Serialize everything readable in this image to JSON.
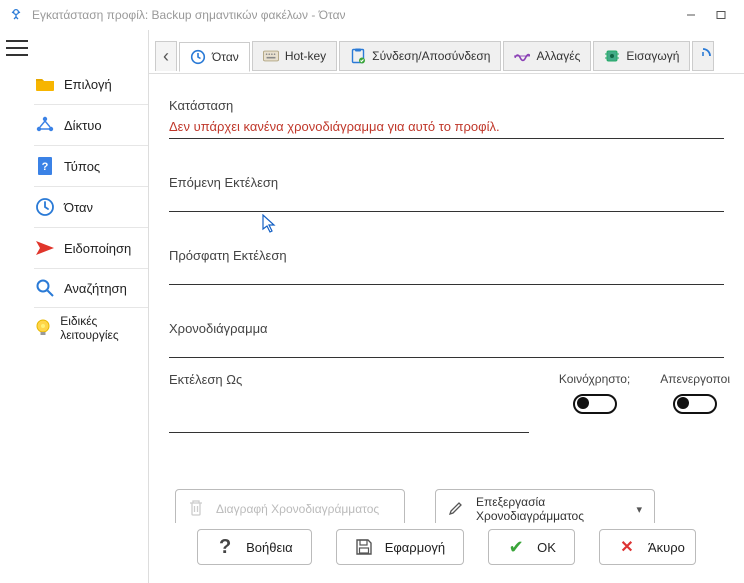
{
  "window": {
    "title": "Εγκατάσταση προφίλ: Backup σημαντικών φακέλων - Όταν"
  },
  "sidebar": {
    "items": [
      {
        "label": "Επιλογή",
        "icon": "folder-icon"
      },
      {
        "label": "Δίκτυο",
        "icon": "network-icon"
      },
      {
        "label": "Τύπος",
        "icon": "type-icon"
      },
      {
        "label": "Όταν",
        "icon": "clock-icon"
      },
      {
        "label": "Ειδοποίηση",
        "icon": "notify-icon"
      },
      {
        "label": "Αναζήτηση",
        "icon": "search-icon"
      },
      {
        "label": "Ειδικές λειτουργίες",
        "icon": "bulb-icon"
      }
    ]
  },
  "tabs": {
    "items": [
      {
        "label": "Όταν",
        "icon": "clock-icon"
      },
      {
        "label": "Hot-key",
        "icon": "keyboard-icon"
      },
      {
        "label": "Σύνδεση/Αποσύνδεση",
        "icon": "clipboard-icon"
      },
      {
        "label": "Αλλαγές",
        "icon": "wave-icon"
      },
      {
        "label": "Εισαγωγή",
        "icon": "chip-icon"
      }
    ]
  },
  "sections": {
    "status": {
      "label": "Κατάσταση",
      "value": "Δεν υπάρχει κανένα χρονοδιάγραμμα για αυτό το προφίλ."
    },
    "next": {
      "label": "Επόμενη Εκτέλεση",
      "value": ""
    },
    "recent": {
      "label": "Πρόσφατη Εκτέλεση",
      "value": ""
    },
    "schedule": {
      "label": "Χρονοδιάγραμμα",
      "value": ""
    },
    "runas": {
      "label": "Εκτέλεση Ως"
    },
    "shared": {
      "label": "Κοινόχρηστο;"
    },
    "disabled": {
      "label": "Απενεργοποι"
    }
  },
  "buttons": {
    "delete_schedule": "Διαγραφή Χρονοδιαγράμματος",
    "edit_schedule_l1": "Επεξεργασία",
    "edit_schedule_l2": "Χρονοδιαγράμματος"
  },
  "footer": {
    "help": "Βοήθεια",
    "apply": "Εφαρμογή",
    "ok": "OK",
    "cancel": "Άκυρο"
  }
}
